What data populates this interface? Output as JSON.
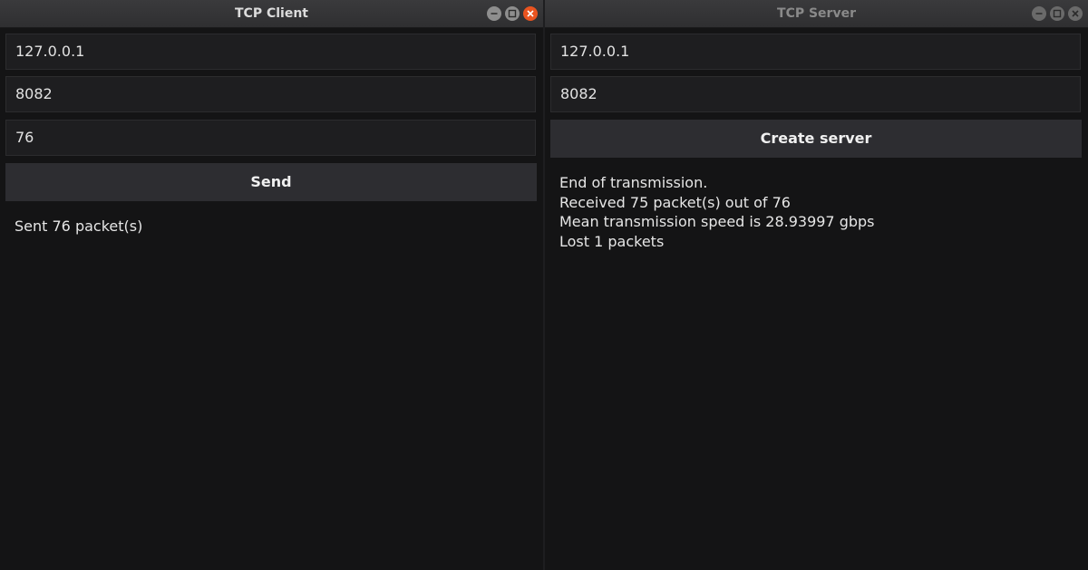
{
  "client": {
    "title": "TCP Client",
    "host": "127.0.0.1",
    "port": "8082",
    "packet_count": "76",
    "send_label": "Send",
    "status": [
      "Sent 76 packet(s)"
    ]
  },
  "server": {
    "title": "TCP Server",
    "host": "127.0.0.1",
    "port": "8082",
    "create_label": "Create server",
    "status": [
      "End of transmission.",
      "Received 75 packet(s) out of 76",
      "Mean transmission speed is 28.93997 gbps",
      "Lost 1 packets"
    ]
  },
  "colors": {
    "close_button_active": "#e95420",
    "background": "#141415"
  },
  "icons": {
    "minimize": "minimize-icon",
    "maximize": "maximize-icon",
    "close": "close-icon"
  }
}
